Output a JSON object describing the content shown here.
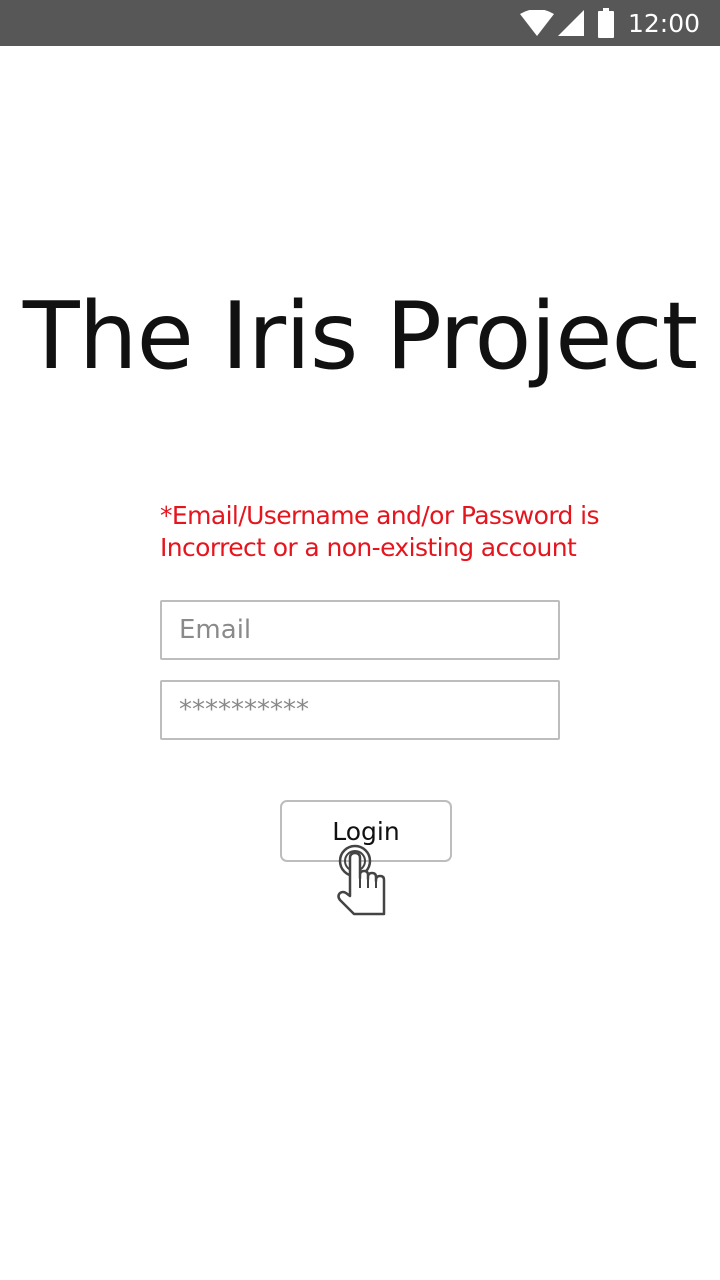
{
  "status_bar": {
    "time": "12:00",
    "icons": [
      "wifi-icon",
      "cellular-signal-icon",
      "battery-icon"
    ]
  },
  "app": {
    "title": "The Iris Project"
  },
  "login_form": {
    "error_message": "*Email/Username and/or Password is Incorrect or a non-existing account",
    "email_placeholder": "Email",
    "password_placeholder": "**********",
    "login_label": "Login"
  },
  "colors": {
    "status_bar": "#575757",
    "error": "#e5151e",
    "border": "#bdbdbd",
    "title": "#111111"
  },
  "cursor": {
    "icon": "hand-pointer-icon"
  }
}
